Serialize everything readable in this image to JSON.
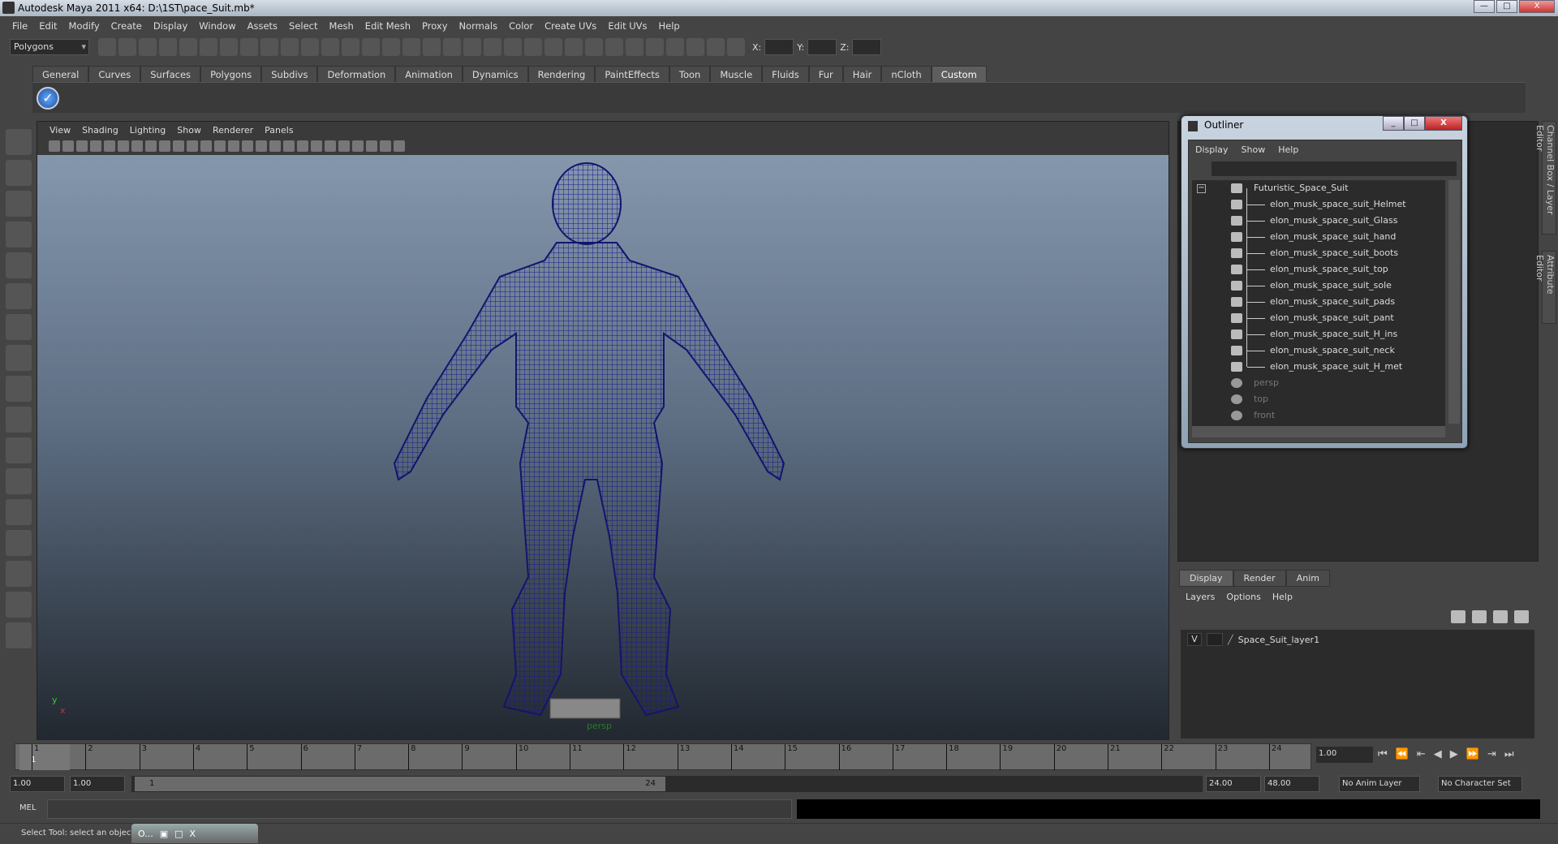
{
  "window": {
    "title": "Autodesk Maya 2011 x64: D:\\1ST\\pace_Suit.mb*",
    "minimize": "—",
    "maximize": "□",
    "close": "X"
  },
  "menubar": [
    "File",
    "Edit",
    "Modify",
    "Create",
    "Display",
    "Window",
    "Assets",
    "Select",
    "Mesh",
    "Edit Mesh",
    "Proxy",
    "Normals",
    "Color",
    "Create UVs",
    "Edit UVs",
    "Help"
  ],
  "toolbar": {
    "mode": "Polygons",
    "x_label": "X:",
    "y_label": "Y:",
    "z_label": "Z:"
  },
  "shelf_tabs": [
    "General",
    "Curves",
    "Surfaces",
    "Polygons",
    "Subdivs",
    "Deformation",
    "Animation",
    "Dynamics",
    "Rendering",
    "PaintEffects",
    "Toon",
    "Muscle",
    "Fluids",
    "Fur",
    "Hair",
    "nCloth",
    "Custom"
  ],
  "shelf_active": "Custom",
  "viewport": {
    "menu": [
      "View",
      "Shading",
      "Lighting",
      "Show",
      "Renderer",
      "Panels"
    ],
    "camera_label": "persp",
    "axis_y": "y",
    "axis_x": "x",
    "wire_color": "#1a1a8c"
  },
  "side_tabs": [
    "Channel Box / Layer Editor",
    "Attribute Editor"
  ],
  "outliner": {
    "title": "Outliner",
    "menu": [
      "Display",
      "Show",
      "Help"
    ],
    "root": "Futuristic_Space_Suit",
    "children": [
      "elon_musk_space_suit_Helmet",
      "elon_musk_space_suit_Glass",
      "elon_musk_space_suit_hand",
      "elon_musk_space_suit_boots",
      "elon_musk_space_suit_top",
      "elon_musk_space_suit_sole",
      "elon_musk_space_suit_pads",
      "elon_musk_space_suit_pant",
      "elon_musk_space_suit_H_ins",
      "elon_musk_space_suit_neck",
      "elon_musk_space_suit_H_met"
    ],
    "cameras": [
      "persp",
      "top",
      "front"
    ]
  },
  "layer_editor": {
    "tabs": [
      "Display",
      "Render",
      "Anim"
    ],
    "menu": [
      "Layers",
      "Options",
      "Help"
    ],
    "layers": [
      {
        "visible": "V",
        "name": "Space_Suit_layer1"
      }
    ]
  },
  "timeline": {
    "frames": [
      "1",
      "2",
      "3",
      "4",
      "5",
      "6",
      "7",
      "8",
      "9",
      "10",
      "11",
      "12",
      "13",
      "14",
      "15",
      "16",
      "17",
      "18",
      "19",
      "20",
      "21",
      "22",
      "23",
      "24"
    ],
    "current_frame": "1",
    "current_field": "1.00"
  },
  "range": {
    "start": "1.00",
    "playback_start": "1.00",
    "slider_start": "1",
    "slider_end": "24",
    "playback_end": "24.00",
    "end": "48.00",
    "anim_layer": "No Anim Layer",
    "character_set": "No Character Set"
  },
  "mel": {
    "label": "MEL"
  },
  "help_line": "Select Tool: select an object",
  "task_window": {
    "label": "O..."
  }
}
